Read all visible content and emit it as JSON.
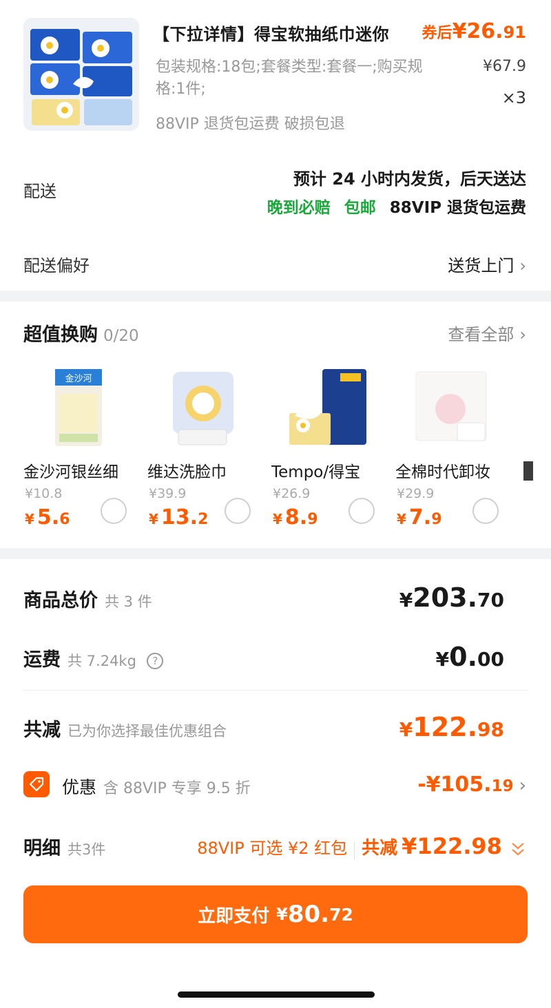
{
  "colors": {
    "accent": "#ff5a00",
    "button": "#ff6a0e",
    "green": "#1aaa3a"
  },
  "product": {
    "title": "【下拉详情】得宝软抽纸巾迷你",
    "coupon_label": "券后",
    "coupon_price_int": "¥26.",
    "coupon_price_dec": "91",
    "spec": "包装规格:18包;套餐类型:套餐一;购买规格:1件;",
    "original_price": "¥67.9",
    "quantity": "×3",
    "tags": "88VIP 退货包运费  破损包退"
  },
  "delivery": {
    "label": "配送",
    "line1": "预计 24 小时内发货，后天送达",
    "tag_late": "晚到必赔",
    "tag_free": "包邮",
    "tag_return": "88VIP 退货包运费"
  },
  "delivery_pref": {
    "label": "配送偏好",
    "value": "送货上门",
    "chevron": "chevron-right-icon"
  },
  "swap": {
    "title": "超值换购",
    "count": "0/20",
    "view_all": "查看全部",
    "items": [
      {
        "name": "金沙河银丝细",
        "orig": "¥10.8",
        "yen": "¥",
        "int": "5.",
        "dec": "6"
      },
      {
        "name": "维达洗脸巾",
        "orig": "¥39.9",
        "yen": "¥",
        "int": "13.",
        "dec": "2"
      },
      {
        "name": "Tempo/得宝",
        "orig": "¥26.9",
        "yen": "¥",
        "int": "8.",
        "dec": "9"
      },
      {
        "name": "全棉时代卸妆",
        "orig": "¥29.9",
        "yen": "¥",
        "int": "7.",
        "dec": "9"
      }
    ]
  },
  "totals": {
    "goods_label": "商品总价",
    "goods_sub": "共 3 件",
    "goods_yen": "¥",
    "goods_int": "203.",
    "goods_dec": "70",
    "ship_label": "运费",
    "ship_sub": "共 7.24kg",
    "ship_yen": "¥",
    "ship_int": "0.",
    "ship_dec": "00",
    "reduce_label": "共减",
    "reduce_sub": "已为你选择最佳优惠组合",
    "reduce_yen": "¥",
    "reduce_int": "122.",
    "reduce_dec": "98"
  },
  "coupon": {
    "label": "优惠",
    "sub": "含 88VIP 专享 9.5 折",
    "value_int": "-¥105.",
    "value_dec": "19"
  },
  "detail": {
    "label": "明细",
    "sub": "共3件",
    "hongbao": "88VIP 可选 ¥2 红包",
    "reduce_label": "共减",
    "reduce_val": "¥122.98"
  },
  "pay": {
    "label": "立即支付",
    "yen": "¥",
    "int": "80.",
    "dec": "72"
  }
}
